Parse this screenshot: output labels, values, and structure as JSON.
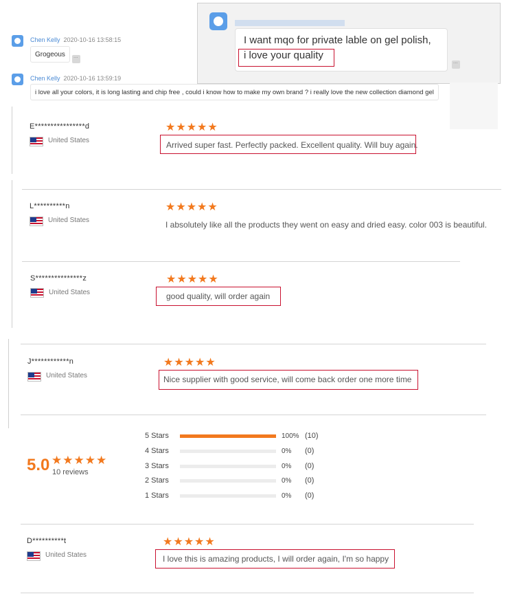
{
  "chat": {
    "messages": [
      {
        "author": "Chen Kelly",
        "time": "2020-10-16 13:58:15",
        "text": "Grogeous"
      },
      {
        "author": "Chen Kelly",
        "time": "2020-10-16 13:59:19",
        "text": "i love all your colors, it is long lasting and chip free , could i know how to make my own brand ? i really love the new collection diamond gel"
      }
    ],
    "popup": {
      "line1": "I want mqo for private lable on gel polish,",
      "line2": "i love your quality"
    }
  },
  "reviews": [
    {
      "reviewer": "E****************d",
      "country": "United States",
      "stars": "★★★★★",
      "text": "Arrived super fast. Perfectly packed. Excellent quality. Will buy again."
    },
    {
      "reviewer": "L**********n",
      "country": "United States",
      "stars": "★★★★★",
      "text": "I absolutely like all the products they went on easy and dried easy. color 003 is beautiful."
    },
    {
      "reviewer": "S***************z",
      "country": "United States",
      "stars": "★★★★★",
      "text": "good quality, will order again"
    },
    {
      "reviewer": "J************n",
      "country": "United States",
      "stars": "★★★★★",
      "text": "Nice supplier with good service, will come back order one more time"
    },
    {
      "reviewer": "D**********t",
      "country": "United States",
      "stars": "★★★★★",
      "text": "I love this is amazing products, I will order again, I'm so happy"
    }
  ],
  "summary": {
    "average": "5.0",
    "stars": "★★★★★",
    "count_label": "10 reviews",
    "breakdown": [
      {
        "label": "5 Stars",
        "fraction": 1.0,
        "pct": "100%",
        "count": "(10)"
      },
      {
        "label": "4 Stars",
        "fraction": 0.0,
        "pct": "0%",
        "count": "(0)"
      },
      {
        "label": "3 Stars",
        "fraction": 0.0,
        "pct": "0%",
        "count": "(0)"
      },
      {
        "label": "2 Stars",
        "fraction": 0.0,
        "pct": "0%",
        "count": "(0)"
      },
      {
        "label": "1 Stars",
        "fraction": 0.0,
        "pct": "0%",
        "count": "(0)"
      }
    ]
  },
  "colors": {
    "accent": "#f2791e",
    "highlight": "#c8102e",
    "link": "#4a8ad4"
  }
}
